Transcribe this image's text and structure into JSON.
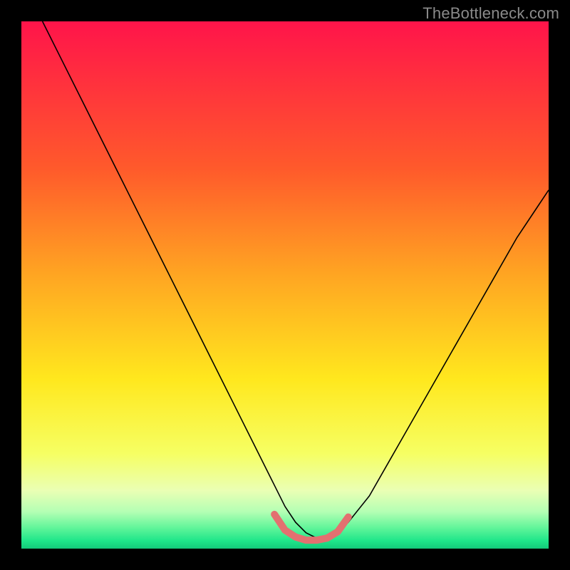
{
  "watermark": "TheBottleneck.com",
  "chart_data": {
    "type": "line",
    "title": "",
    "xlabel": "",
    "ylabel": "",
    "xlim": [
      0,
      100
    ],
    "ylim": [
      0,
      100
    ],
    "background_gradient": {
      "stops": [
        {
          "offset": 0.0,
          "color": "#ff144a"
        },
        {
          "offset": 0.28,
          "color": "#ff5a2b"
        },
        {
          "offset": 0.48,
          "color": "#ffa522"
        },
        {
          "offset": 0.68,
          "color": "#ffe81e"
        },
        {
          "offset": 0.82,
          "color": "#f6ff63"
        },
        {
          "offset": 0.89,
          "color": "#eaffb4"
        },
        {
          "offset": 0.93,
          "color": "#b4ffb4"
        },
        {
          "offset": 0.96,
          "color": "#62f59a"
        },
        {
          "offset": 0.985,
          "color": "#1fe68a"
        },
        {
          "offset": 1.0,
          "color": "#14c97a"
        }
      ]
    },
    "series": [
      {
        "name": "bottleneck-curve",
        "color": "#000000",
        "width": 1.6,
        "x": [
          4,
          8,
          12,
          16,
          20,
          24,
          28,
          32,
          36,
          40,
          44,
          48,
          50,
          52,
          54,
          56,
          58,
          60,
          62,
          66,
          70,
          74,
          78,
          82,
          86,
          90,
          94,
          98,
          100
        ],
        "y": [
          100,
          92,
          84,
          76,
          68,
          60,
          52,
          44,
          36,
          28,
          20,
          12,
          8,
          5,
          3,
          2,
          2,
          3,
          5,
          10,
          17,
          24,
          31,
          38,
          45,
          52,
          59,
          65,
          68
        ]
      },
      {
        "name": "optimal-band",
        "color": "#e37070",
        "width": 10,
        "linecap": "round",
        "x": [
          48,
          50,
          52,
          54,
          56,
          58,
          60,
          62
        ],
        "y": [
          6.5,
          3.5,
          2.2,
          1.6,
          1.6,
          2.0,
          3.2,
          6.0
        ]
      }
    ]
  }
}
